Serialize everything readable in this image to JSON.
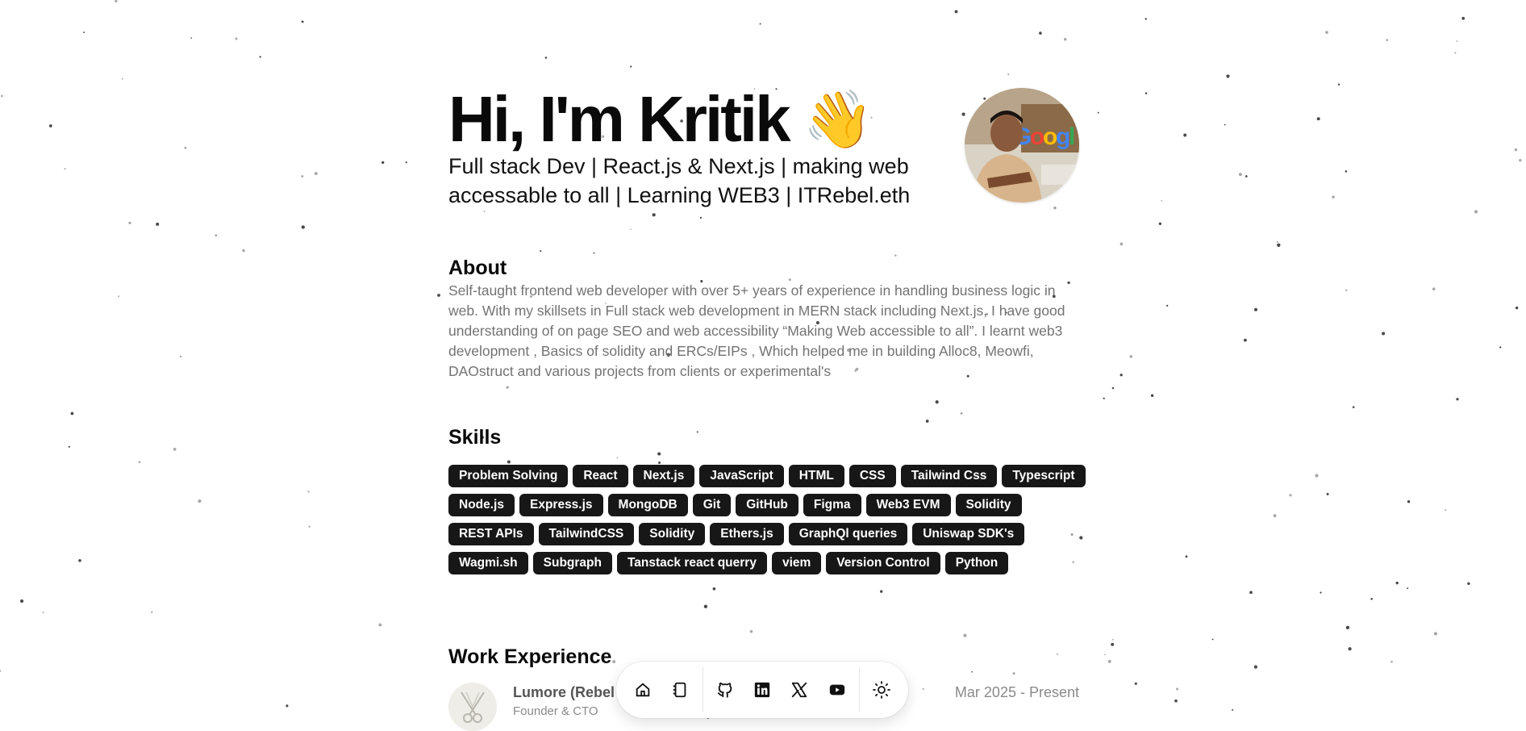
{
  "hero": {
    "title": "Hi, I'm Kritik",
    "wave_emoji": "👋",
    "subtitle": "Full stack Dev | React.js & Next.js | making web accessable to all | Learning WEB3 | ITRebel.eth",
    "avatar_icon": "profile-photo"
  },
  "about": {
    "heading": "About",
    "text": "Self-taught frontend web developer with over 5+ years of experience in handling business logic in web. With my skillsets in Full stack web development in MERN stack including Next.js, I have good understanding of on page SEO and web accessibility “Making Web accessible to all”. I learnt web3 development , Basics of solidity and ERCs/EIPs , Which helped me in building Alloc8, Meowfi, DAOstruct and various projects from clients or experimental's"
  },
  "skills": {
    "heading": "Skills",
    "items": [
      "Problem Solving",
      "React",
      "Next.js",
      "JavaScript",
      "HTML",
      "CSS",
      "Tailwind Css",
      "Typescript",
      "Node.js",
      "Express.js",
      "MongoDB",
      "Git",
      "GitHub",
      "Figma",
      "Web3 EVM",
      "Solidity",
      "REST APIs",
      "TailwindCSS",
      "Solidity",
      "Ethers.js",
      "GraphQl queries",
      "Uniswap SDK's",
      "Wagmi.sh",
      "Subgraph",
      "Tanstack react querry",
      "viem",
      "Version Control",
      "Python"
    ]
  },
  "work": {
    "heading": "Work Experience",
    "items": [
      {
        "company": "Lumore (Rebel",
        "role": "Founder & CTO",
        "dates": "Mar 2025 - Present"
      }
    ]
  },
  "dock": {
    "items": [
      {
        "icon": "home-icon"
      },
      {
        "icon": "notebook-icon"
      },
      {
        "icon": "github-icon"
      },
      {
        "icon": "linkedin-icon"
      },
      {
        "icon": "x-icon"
      },
      {
        "icon": "youtube-icon"
      },
      {
        "icon": "sun-icon"
      }
    ]
  },
  "colors": {
    "chip_bg": "#171717",
    "chip_text": "#ffffff",
    "muted_text": "#737373",
    "background": "#ffffff"
  }
}
